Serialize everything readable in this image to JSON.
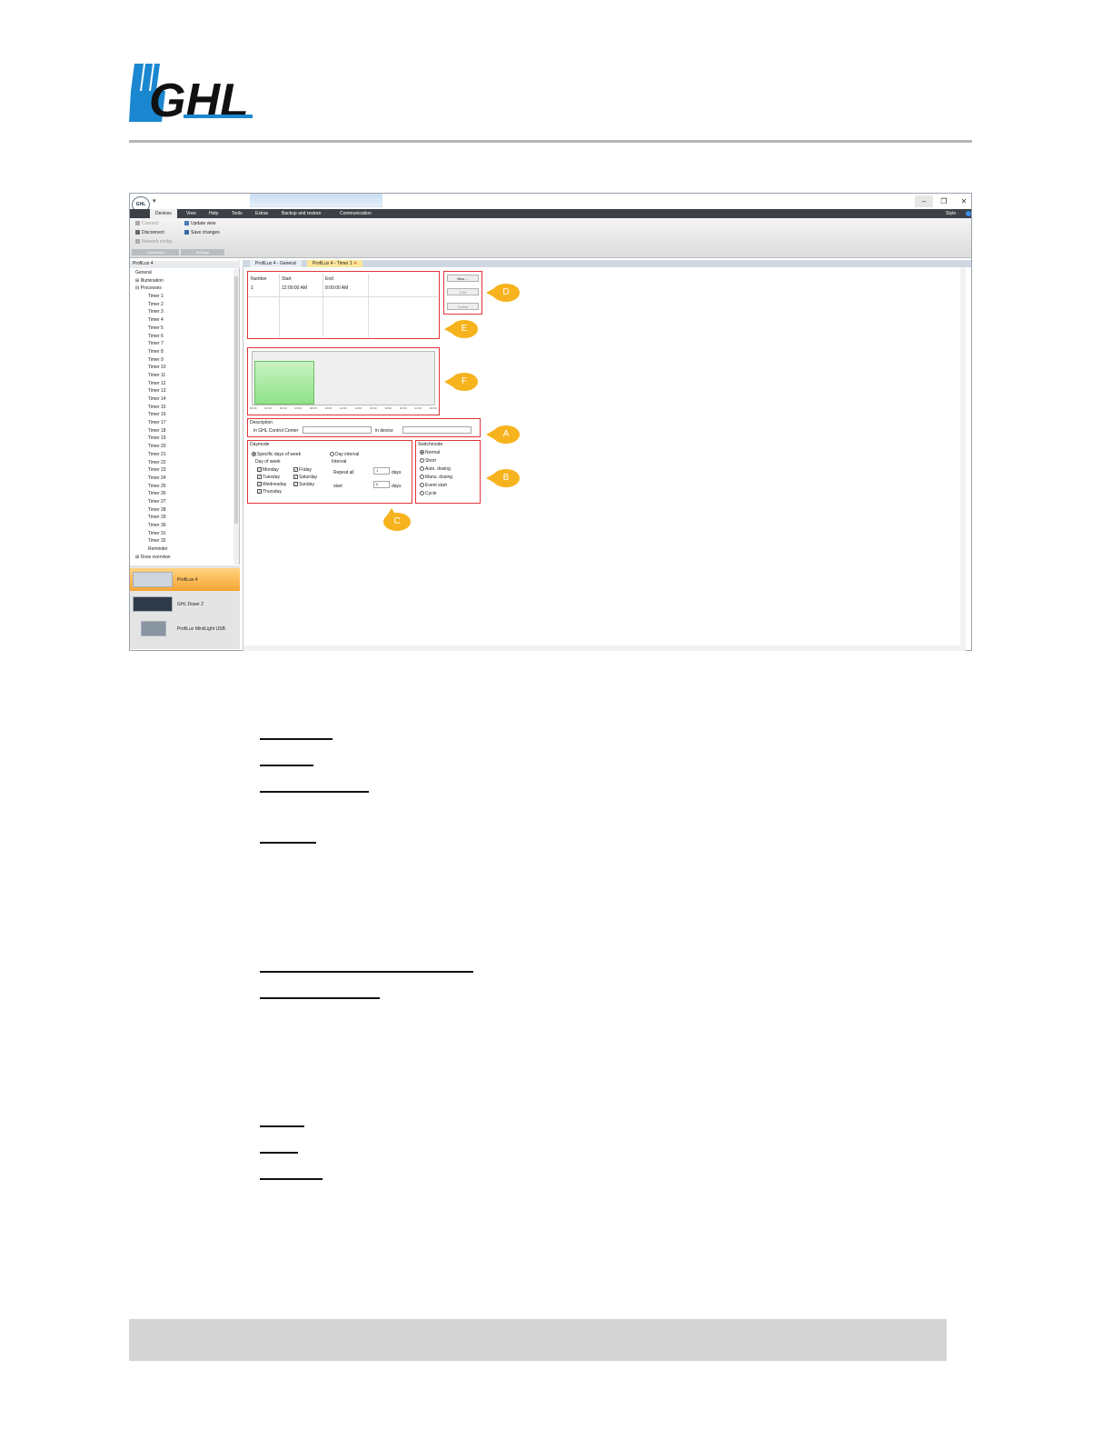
{
  "brand": {
    "logo_text": "GHL",
    "logo_color": "#1a87d0"
  },
  "window": {
    "orb_text": "GHL",
    "qa_text": "▾",
    "controls": {
      "minimize": "–",
      "restore": "❐",
      "close": "✕"
    },
    "style_label": "Style ·",
    "menu": [
      "Devices",
      "View",
      "Help",
      "Tools",
      "Extras",
      "Backup and restore",
      "Communication"
    ],
    "ribbon": {
      "connect": "Connect",
      "disconnect": "Disconnect",
      "network_config": "Network config...",
      "update_view": "Update view",
      "save_changes": "Save changes",
      "group_connection": "Connection",
      "group_settings": "Settings"
    }
  },
  "tree": {
    "header": "ProfiLux 4",
    "items": [
      "General",
      "Illumination",
      "Processes",
      "Timer 1",
      "Timer 2",
      "Timer 3",
      "Timer 4",
      "Timer 5",
      "Timer 6",
      "Timer 7",
      "Timer 8",
      "Timer 9",
      "Timer 10",
      "Timer 11",
      "Timer 12",
      "Timer 13",
      "Timer 14",
      "Timer 15",
      "Timer 16",
      "Timer 17",
      "Timer 18",
      "Timer 19",
      "Timer 20",
      "Timer 21",
      "Timer 22",
      "Timer 23",
      "Timer 24",
      "Timer 25",
      "Timer 26",
      "Timer 27",
      "Timer 28",
      "Timer 29",
      "Timer 30",
      "Timer 31",
      "Timer 32",
      "Reminder",
      "Dose overview"
    ]
  },
  "devices": [
    "ProfiLux 4",
    "GHL Doser 2",
    "ProfiLux Mini/Light USB"
  ],
  "tabs": {
    "general": "ProfiLux 4 - General",
    "timer": "ProfiLux 4 - Timer 1",
    "close": "✕"
  },
  "table": {
    "headers": [
      "Number",
      "Start",
      "End"
    ],
    "row": [
      "1",
      "12:00:00 AM",
      "8:00:00 AM"
    ]
  },
  "buttons": {
    "new": "New ...",
    "edit": "Edit",
    "delete": "Delete"
  },
  "chart_ticks": [
    "00:00",
    "02:00",
    "04:00",
    "06:00",
    "08:00",
    "10:00",
    "12:00",
    "14:00",
    "16:00",
    "18:00",
    "20:00",
    "22:00",
    "00:00"
  ],
  "description": {
    "title": "Description",
    "ccc_label": "in GHL Control Center",
    "device_label": "in device"
  },
  "daymode": {
    "title": "Daymode",
    "specific": "Specific days of week",
    "interval": "Day interval",
    "dow_title": "Day of week",
    "days": [
      "Monday",
      "Tuesday",
      "Wednesday",
      "Thursday",
      "Friday",
      "Saturday",
      "Sunday"
    ],
    "interval_title": "Interval",
    "repeat_label": "Repeat all",
    "repeat_value": "1",
    "days_unit": "days",
    "start_label": "start",
    "start_value": "0"
  },
  "switchmode": {
    "title": "Switchmode",
    "options": [
      "Normal",
      "Short",
      "Auto. dosing",
      "Manu. dosing",
      "Event start",
      "Cycle"
    ]
  },
  "callouts": [
    "A",
    "B",
    "C",
    "D",
    "E",
    "F"
  ]
}
